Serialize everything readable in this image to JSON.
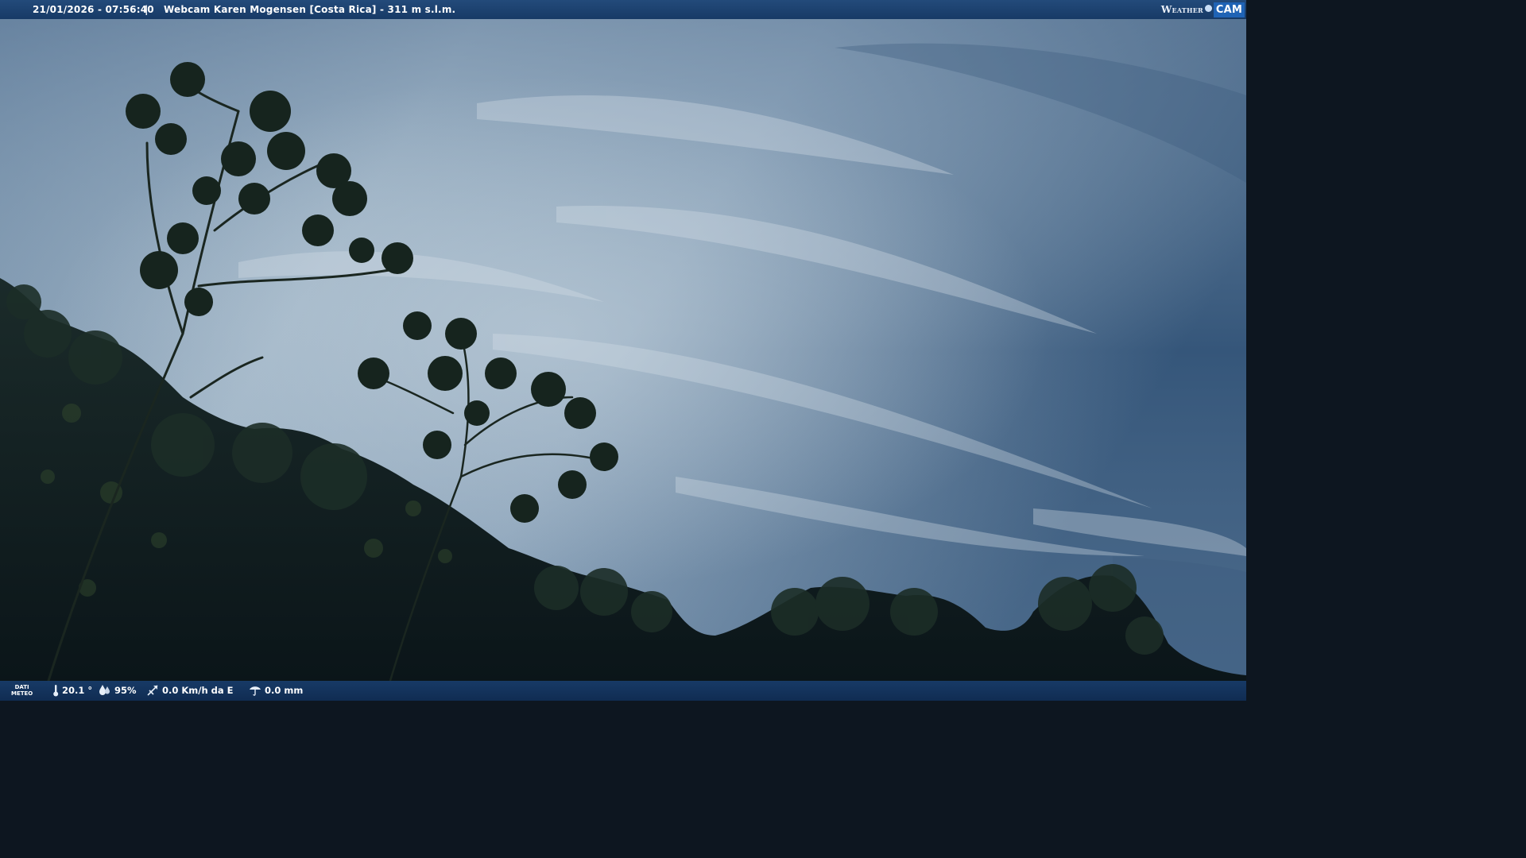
{
  "header": {
    "datetime": "21/01/2026 - 07:56:40",
    "separator": "|",
    "title": "Webcam Karen Mogensen [Costa Rica]  - 311 m s.l.m."
  },
  "logo": {
    "word1": "Weather",
    "word2": "CAM"
  },
  "weather_bar": {
    "label_line1": "DATI",
    "label_line2": "METEO",
    "temperature": "20.1 °",
    "humidity": "95%",
    "wind": "0.0 Km/h da E",
    "rain": "0.0 mm",
    "icons": [
      "thermometer-icon",
      "humidity-drop-icon",
      "wind-vane-icon",
      "rain-gauge-icon"
    ]
  },
  "colors": {
    "sky_light": "#a9bccb",
    "sky_dark": "#2e4a6a",
    "foliage": "#0f1d1f",
    "bar_blue": "#1a3f6e"
  }
}
